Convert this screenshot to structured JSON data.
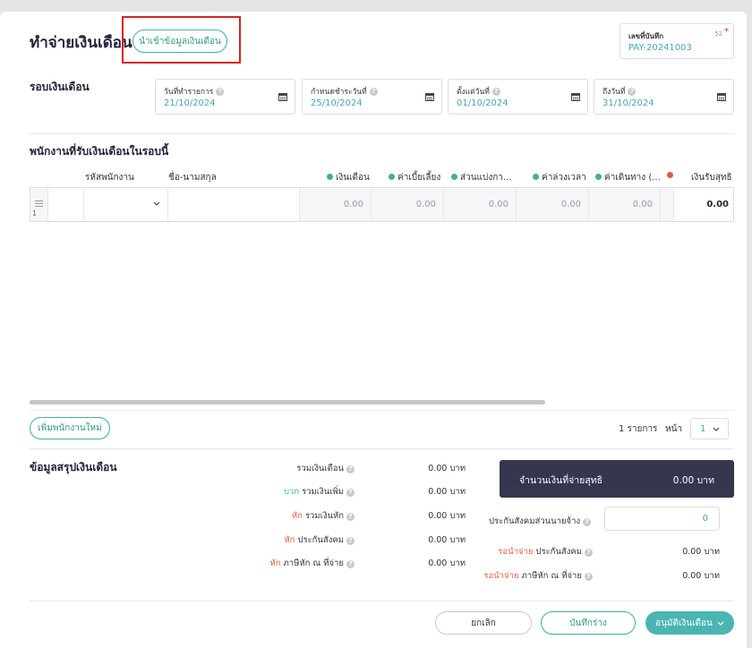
{
  "header": {
    "title": "ทำจ่ายเงินเดือน",
    "import_button": "นำเข้าข้อมูลเงินเดือน",
    "doc_number": {
      "label": "เลขที่บันทึก",
      "char_count": "52",
      "required_mark": "*",
      "value": "PAY-20241003"
    }
  },
  "period": {
    "title": "รอบเงินเดือน",
    "fields": [
      {
        "label": "วันที่ทำรายการ",
        "value": "21/10/2024"
      },
      {
        "label": "กำหนดชำระวันที่",
        "value": "25/10/2024"
      },
      {
        "label": "ตั้งแต่วันที่",
        "value": "01/10/2024"
      },
      {
        "label": "ถึงวันที่",
        "value": "31/10/2024"
      }
    ]
  },
  "employees": {
    "title": "พนักงานที่รับเงินเดือนในรอบนี้",
    "columns": [
      "รหัสพนักงาน",
      "ชื่อ-นามสกุล",
      "เงินเดือน",
      "ค่าเบี้ยเลี้ยง",
      "ส่วนแบ่งกา...",
      "ค่าล่วงเวลา",
      "ค่าเดินทาง (...",
      "",
      "เงินรับสุทธิ"
    ],
    "rows": [
      {
        "index": "1",
        "salary": "0.00",
        "allowance": "0.00",
        "share": "0.00",
        "overtime": "0.00",
        "travel": "0.00",
        "net": "0.00"
      }
    ],
    "add_button": "เพิ่มพนักงานใหม่",
    "pager": {
      "count_text": "1 รายการ",
      "page_label": "หน้า",
      "page": "1"
    }
  },
  "summary": {
    "title": "ข้อมูลสรุปเงินเดือน",
    "lines": [
      {
        "prefix": "",
        "label": "รวมเงินเดือน",
        "value": "0.00 บาท"
      },
      {
        "prefix": "บวก",
        "label": "รวมเงินเพิ่ม",
        "value": "0.00 บาท"
      },
      {
        "prefix": "หัก",
        "label": "รวมเงินหัก",
        "value": "0.00 บาท"
      },
      {
        "prefix": "หัก",
        "label": "ประกันสังคม",
        "value": "0.00 บาท"
      },
      {
        "prefix": "หัก",
        "label": "ภาษีหัก ณ ที่จ่าย",
        "value": "0.00 บาท"
      }
    ],
    "net": {
      "label": "จำนวนเงินที่จ่ายสุทธิ",
      "value": "0.00 บาท"
    },
    "employer_ss": {
      "label": "ประกันสังคมส่วนนายจ้าง",
      "value": "0"
    },
    "pending": [
      {
        "prefix": "รอนำจ่าย",
        "label": "ประกันสังคม",
        "value": "0.00 บาท"
      },
      {
        "prefix": "รอนำจ่าย",
        "label": "ภาษีหัก ณ ที่จ่าย",
        "value": "0.00 บาท"
      }
    ]
  },
  "footer": {
    "cancel": "ยกเลิก",
    "save_draft": "บันทึกร่าง",
    "approve": "อนุมัติเงินเดือน"
  },
  "colors": {
    "accent": "#3eb489",
    "highlight": "#d32626",
    "dark": "#35374f",
    "link": "#4aa3b8"
  }
}
